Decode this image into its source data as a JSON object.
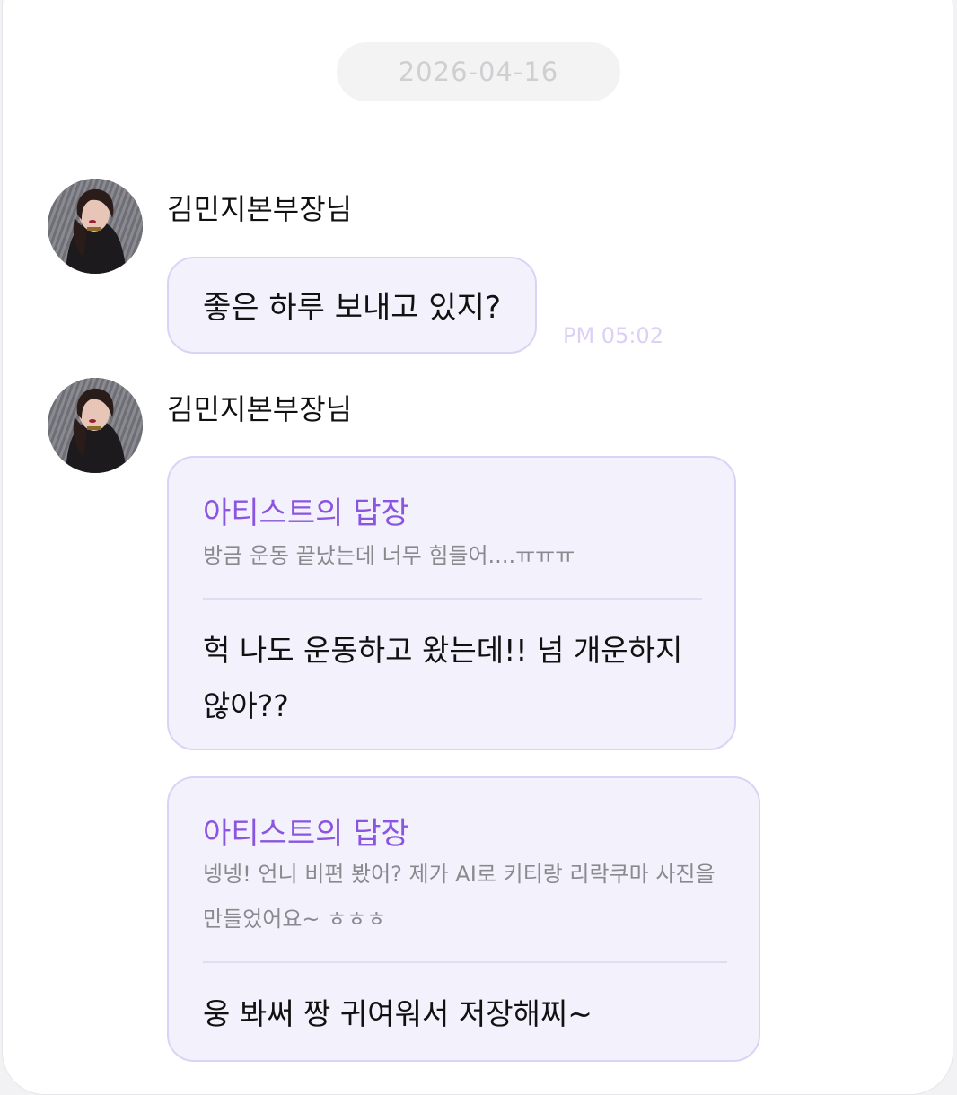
{
  "date_separator": "2026-04-16",
  "messages": [
    {
      "sender": "김민지본부장님",
      "text": "좋은 하루 보내고 있지?",
      "time": "PM 05:02"
    }
  ],
  "replies": [
    {
      "sender": "김민지본부장님",
      "title": "아티스트의 답장",
      "quote": "방금 운동 끝났는데 너무 힘들어....ㅠㅠㅠ",
      "body_line1": "헉 나도 운동하고 왔는데!! 넘 개운하지",
      "body_line2": "않아??"
    },
    {
      "title": "아티스트의 답장",
      "quote_line1": "넹넹! 언니 비편 봤어? 제가 AI로 키티랑 리락쿠마 사진을",
      "quote_line2": "만들었어요~ ㅎㅎㅎ",
      "body": "웅 봐써 짱 귀여워서 저장해찌~"
    }
  ],
  "colors": {
    "bubble_bg": "#f3f1fb",
    "bubble_border": "#dcd2f7",
    "reply_title": "#8a55e0",
    "time": "#dcd0f5"
  }
}
